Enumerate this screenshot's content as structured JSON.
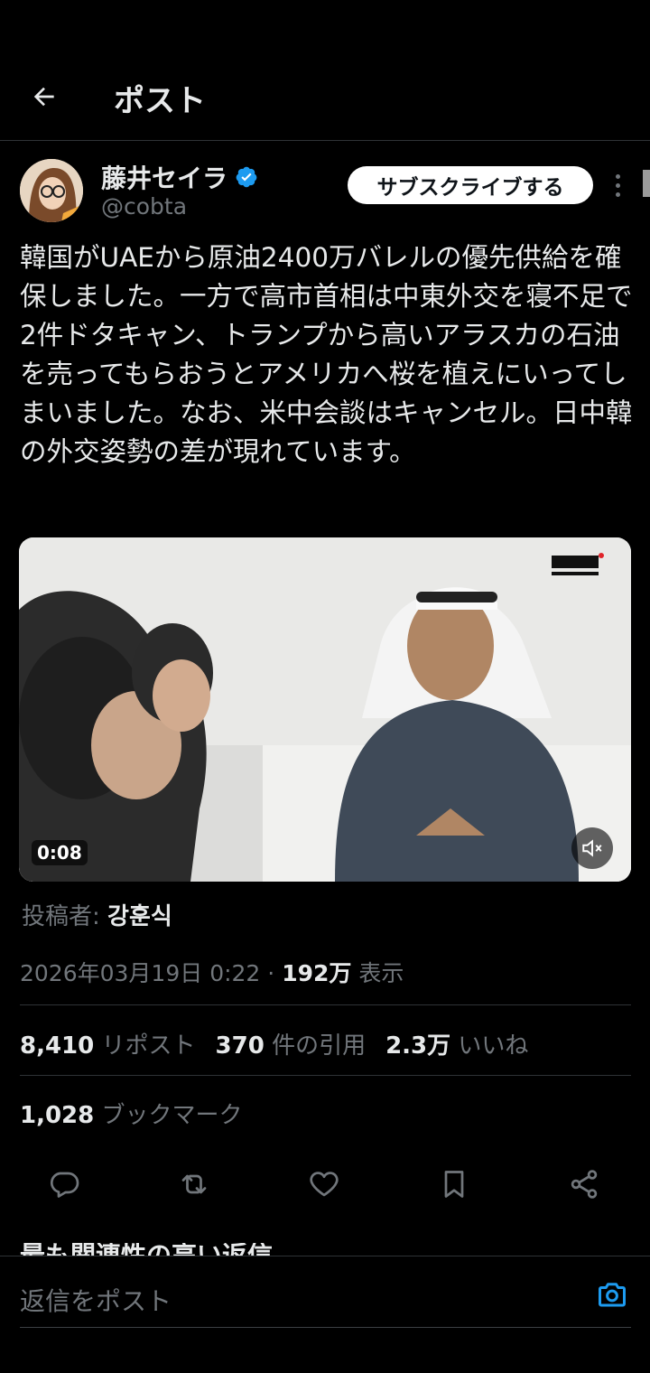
{
  "header": {
    "title": "ポスト",
    "back_icon": "arrow-left-icon"
  },
  "author": {
    "name": "藤井セイラ",
    "handle": "@cobta",
    "verified": true,
    "verified_color": "#1d9bf0",
    "subscribe_label": "サブスクライブする"
  },
  "post": {
    "text": "韓国がUAEから原油2400万バレルの優先供給を確保しました。一方で高市首相は中東外交を寝不足で2件ドタキャン、トランプから高いアラスカの石油を売ってもらおうとアメリカへ桜を植えにいってしまいました。なお、米中会談はキャンセル。日中韓の外交姿勢の差が現れています。"
  },
  "media": {
    "duration": "0:08",
    "mute_icon": "muted-speaker-icon"
  },
  "posted_by": {
    "label": "投稿者:",
    "name": "강훈식"
  },
  "meta": {
    "timestamp": "2026年03月19日 0:22",
    "separator": "·",
    "views_count": "192万",
    "views_label": "表示"
  },
  "stats": {
    "reposts_count": "8,410",
    "reposts_label": "リポスト",
    "quotes_count": "370",
    "quotes_label": "件の引用",
    "likes_count": "2.3万",
    "likes_label": "いいね",
    "bookmarks_count": "1,028",
    "bookmarks_label": "ブックマーク"
  },
  "actions": [
    "reply-icon",
    "repost-icon",
    "like-icon",
    "bookmark-icon",
    "share-icon"
  ],
  "section_cutoff": "最も関連性の高い返信",
  "reply": {
    "placeholder": "返信をポスト",
    "camera_icon": "camera-icon",
    "accent": "#1d9bf0"
  }
}
